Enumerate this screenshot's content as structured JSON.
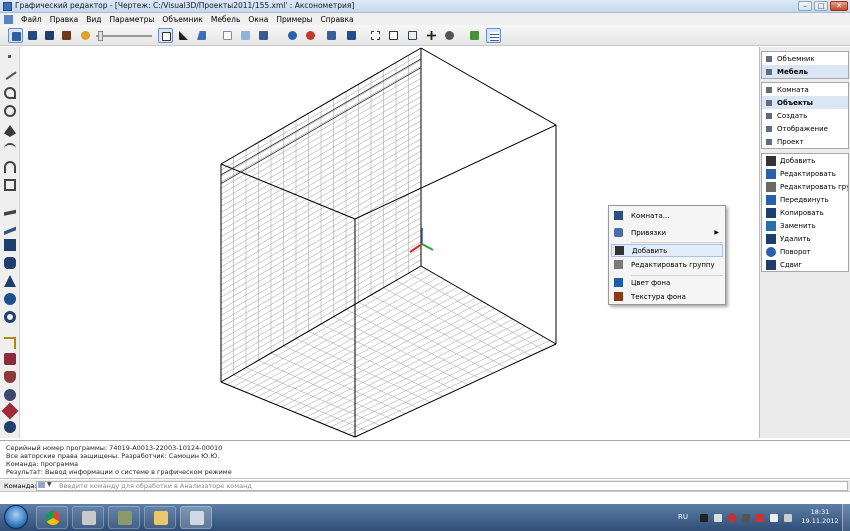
{
  "window": {
    "title": "Графический редактор - [Чертеж: C:/Visual3D/Проекты2011/155.xml' : Аксонометрия]",
    "minimize": "–",
    "maximize": "□",
    "close": "✕"
  },
  "menu": [
    "Файл",
    "Правка",
    "Вид",
    "Параметры",
    "Объемник",
    "Мебель",
    "Окна",
    "Примеры",
    "Справка"
  ],
  "panels": {
    "top": [
      "Объемник",
      "Мебель"
    ],
    "middle": [
      "Комната",
      "Объекты",
      "Создать",
      "Отображение",
      "Проект"
    ],
    "commands": [
      "Добавить",
      "Редактировать",
      "Редактировать гру...",
      "Передвинуть",
      "Копировать",
      "Заменить",
      "Удалить",
      "Поворот",
      "Сдвиг"
    ]
  },
  "context_menu": {
    "items": [
      {
        "label": "Комната...",
        "icon": "room-icon"
      },
      {
        "label": "Привязки",
        "icon": "snap-icon",
        "submenu": true
      },
      {
        "label": "Добавить",
        "icon": "add-icon",
        "highlighted": true
      },
      {
        "label": "Редактировать группу",
        "icon": "edit-group-icon"
      },
      {
        "label": "Цвет фона",
        "icon": "bg-color-icon"
      },
      {
        "label": "Текстура фона",
        "icon": "bg-texture-icon"
      }
    ]
  },
  "console": {
    "lines": [
      "Серийный номер программы: 74019-A0013-22003-10124-00010",
      "Все авторские права защищены. Разработчик: Самоцин Ю.Ю.",
      "Команда: программа",
      "Результат: Вывод информации о системе в графическом режиме"
    ]
  },
  "command_bar": {
    "label": "Команда:",
    "placeholder": "Введите команду для обработки в Анализаторе команд"
  },
  "taskbar": {
    "language": "RU",
    "time": "18:31",
    "date": "19.11.2012"
  },
  "colors": {
    "titlebar": "#c6d8ed",
    "taskbar": "#2f4d75",
    "selection": "#dbe6f4",
    "axis_x": "#d42a2a",
    "axis_y": "#2fa33a",
    "axis_z": "#2a5fd4"
  }
}
